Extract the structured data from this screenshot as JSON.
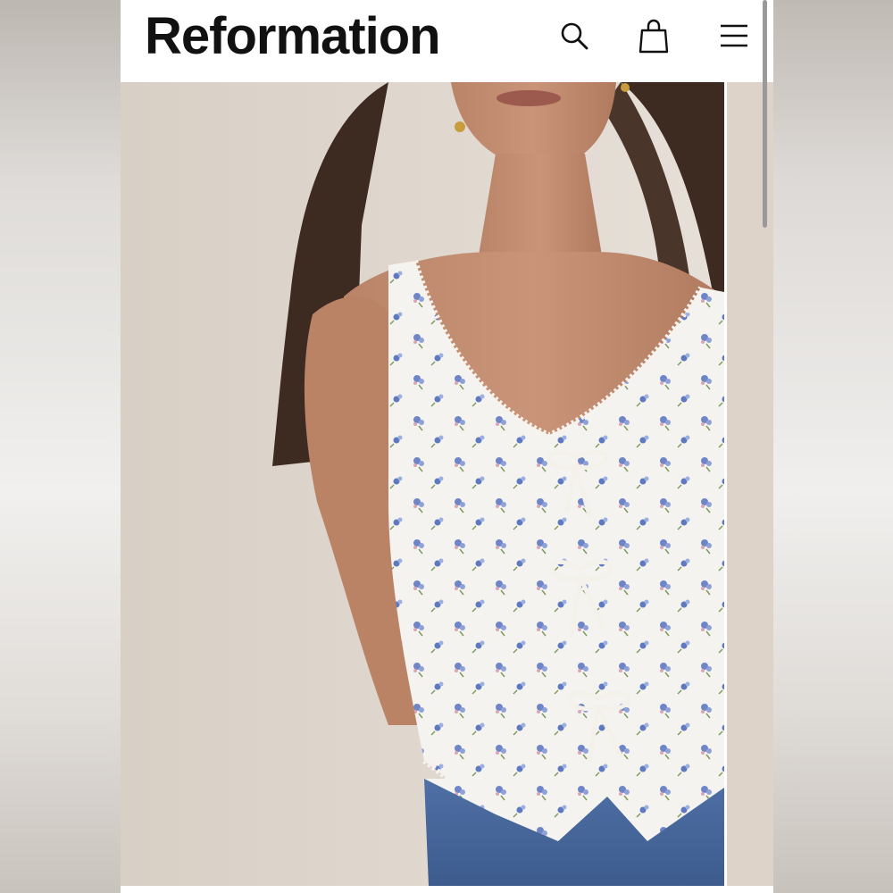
{
  "header": {
    "brand": "Reformation",
    "icons": {
      "search": "search-icon",
      "bag": "shopping-bag-icon",
      "menu": "hamburger-menu-icon"
    }
  },
  "gallery": {
    "main_image": "product-photo-floral-corset-top",
    "next_image": "product-photo-next-slide"
  },
  "colors": {
    "brand_text": "#111111",
    "header_bg": "#ffffff",
    "photo_bg": "#e2dad1"
  }
}
